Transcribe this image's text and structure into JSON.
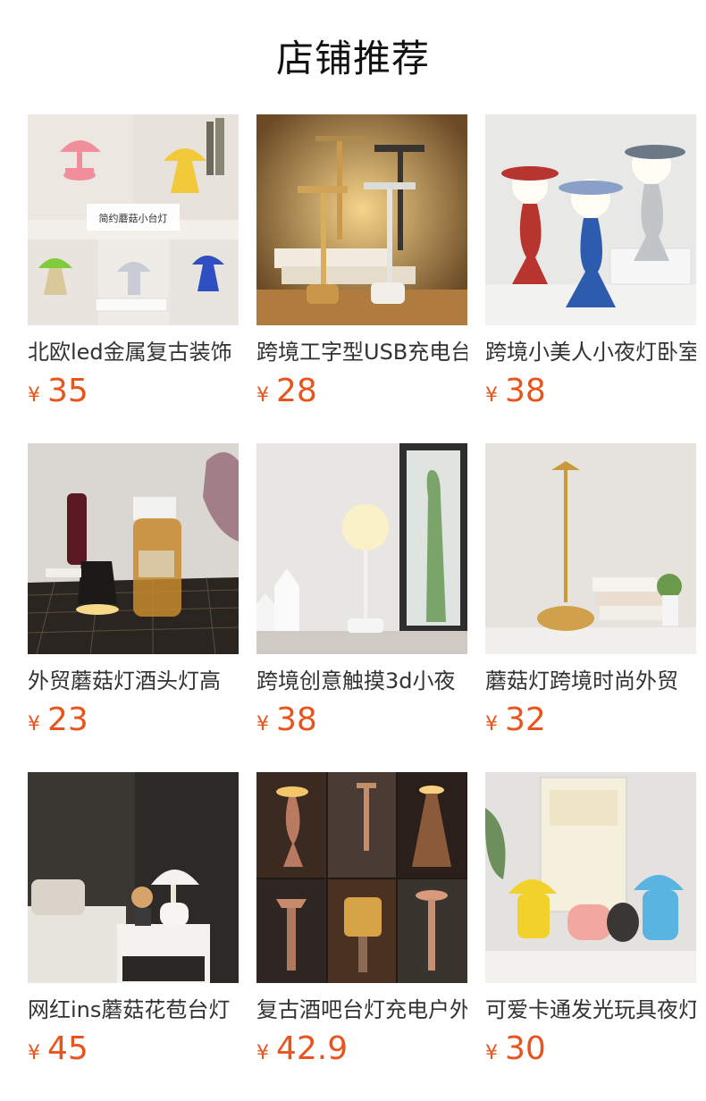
{
  "section_title": "店铺推荐",
  "currency": "¥",
  "accent_color": "#e9531c",
  "products": [
    {
      "name": "北欧led金属复古装饰",
      "price": "35",
      "image": "mushroom-lamp-collage-image",
      "badge": "简约蘑菇小台灯"
    },
    {
      "name": "跨境工字型USB充电台",
      "price": "28",
      "image": "gold-table-lamps-image"
    },
    {
      "name": "跨境小美人小夜灯卧室",
      "price": "38",
      "image": "beauty-night-lights-image"
    },
    {
      "name": "外贸蘑菇灯酒头灯高",
      "price": "23",
      "image": "bottle-cap-lamp-image"
    },
    {
      "name": "跨境创意触摸3d小夜",
      "price": "38",
      "image": "globe-touch-lamp-image"
    },
    {
      "name": "蘑菇灯跨境时尚外贸",
      "price": "32",
      "image": "gold-mushroom-lamp-image"
    },
    {
      "name": "网红ins蘑菇花苞台灯",
      "price": "45",
      "image": "bedside-mushroom-lamp-image"
    },
    {
      "name": "复古酒吧台灯充电户外",
      "price": "42.9",
      "image": "bar-lamps-collage-image"
    },
    {
      "name": "可爱卡通发光玩具夜灯",
      "price": "30",
      "image": "cartoon-lamps-image"
    }
  ]
}
